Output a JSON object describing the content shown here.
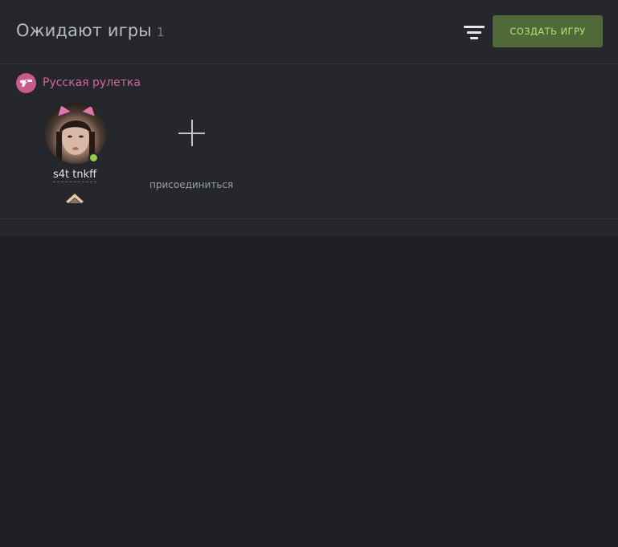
{
  "header": {
    "title": "Ожидают игры",
    "count": "1",
    "create_button_label": "СОЗДАТЬ ИГРУ",
    "filter_icon": "filter-icon"
  },
  "game": {
    "type_label": "Русская рулетка",
    "type_icon": "revolver-icon",
    "player": {
      "name": "s4t tnkff",
      "online": true,
      "rank_icon": "rank-chevron-icon"
    },
    "join_label": "присоединиться",
    "join_icon": "plus-icon"
  },
  "colors": {
    "accent_button_bg": "#4f6a36",
    "accent_button_text": "#b3df7c",
    "game_type_color": "#d06699",
    "online_color": "#8fd14f"
  }
}
